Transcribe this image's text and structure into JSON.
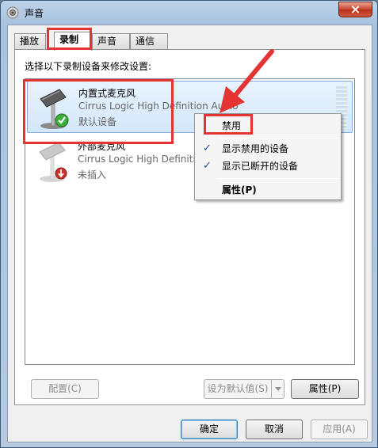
{
  "window": {
    "title": "声音",
    "close_label": "×"
  },
  "tabs": [
    {
      "label": "播放"
    },
    {
      "label": "录制"
    },
    {
      "label": "声音"
    },
    {
      "label": "通信"
    }
  ],
  "panel": {
    "instruction": "选择以下录制设备来修改设置:"
  },
  "devices": [
    {
      "name": "内置式麦克风",
      "driver": "Cirrus Logic High Definition Audio",
      "status": "默认设备"
    },
    {
      "name": "外部麦克风",
      "driver": "Cirrus Logic High Definition Audio",
      "status": "未插入"
    }
  ],
  "context_menu": {
    "disable": "禁用",
    "show_disabled": "显示禁用的设备",
    "show_disconnected": "显示已断开的设备",
    "properties": "属性(P)"
  },
  "panel_buttons": {
    "configure": "配置(C)",
    "set_default": "设为默认值(S)",
    "properties": "属性(P)"
  },
  "dialog_buttons": {
    "ok": "确定",
    "cancel": "取消",
    "apply": "应用(A)"
  },
  "colors": {
    "annotation": "#e53333",
    "selection": "#d4e8fb"
  }
}
